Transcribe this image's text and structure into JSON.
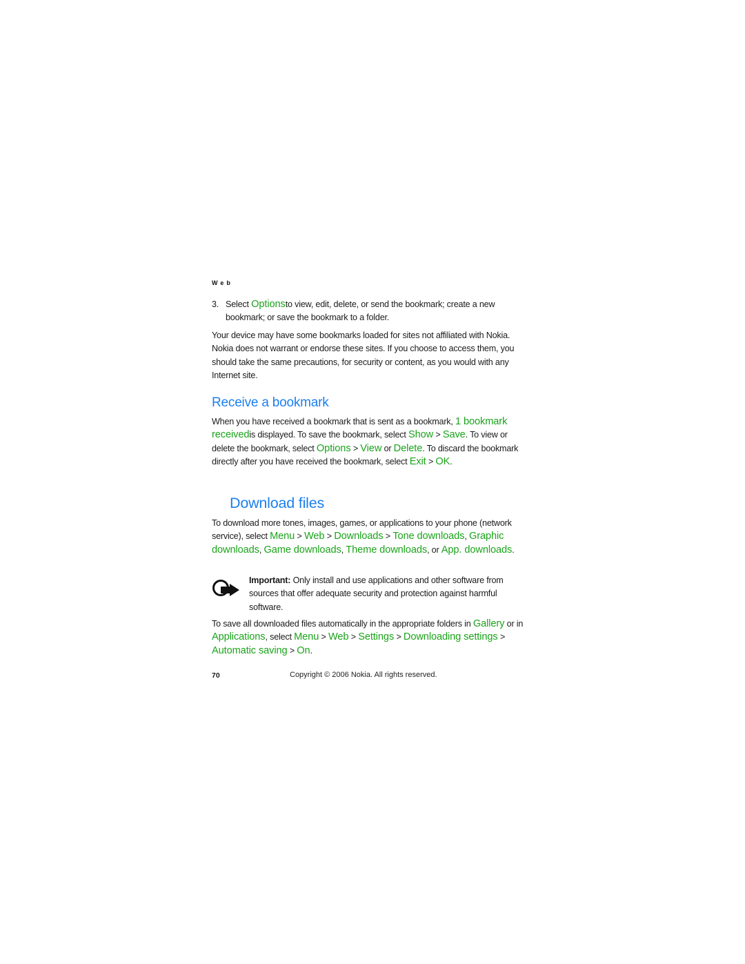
{
  "running_head": "Web",
  "step3": {
    "number": "3.",
    "pre": "Select ",
    "options": "Options",
    "post": "to view, edit, delete, or send the bookmark; create a new bookmark; or save the bookmark to a folder."
  },
  "disclaimer": "Your device may have some bookmarks loaded for sites not affiliated with Nokia. Nokia does not warrant or endorse these sites. If you choose to access them, you should take the same precautions, for security or content, as you would with any Internet site.",
  "receive_section": {
    "heading": "Receive a bookmark",
    "t1": "When you have received a bookmark that is sent as a bookmark, ",
    "g_received": "1 bookmark received",
    "t2": "is displayed. To save the bookmark, select ",
    "g_show": "Show",
    "sep1": " > ",
    "g_save": "Save",
    "t3": ". To view or delete the bookmark, select ",
    "g_options": "Options",
    "sep2": " > ",
    "g_view": "View",
    "t4": " or ",
    "g_delete": "Delete",
    "t5": ". To discard the bookmark directly after you have received the bookmark, select ",
    "g_exit": "Exit",
    "sep3": " > ",
    "g_ok": "OK",
    "t6": "."
  },
  "download_section": {
    "heading": "Download files",
    "t1": "To download more tones, images, games, or applications to your phone (network service), select ",
    "g_menu": "Menu",
    "sep1": " > ",
    "g_web": "Web",
    "sep2": " > ",
    "g_downloads": "Downloads",
    "sep3": " > ",
    "g_tone": "Tone downloads",
    "c1": ", ",
    "g_graphic": "Graphic downloads",
    "c2": ", ",
    "g_game": "Game downloads",
    "c3": ", ",
    "g_theme": "Theme downloads",
    "t2": ", or ",
    "g_app": "App. downloads",
    "t3": "."
  },
  "important_note": {
    "label": "Important:",
    "text": " Only install and use applications and other software from sources that offer adequate security and protection against harmful software."
  },
  "autosave": {
    "t1": "To save all downloaded files automatically in the appropriate folders in ",
    "g_gallery": "Gallery",
    "t2": " or in ",
    "g_applications": "Applications",
    "t3": ", select ",
    "g_menu": "Menu",
    "sep1": " > ",
    "g_web": "Web",
    "sep2": " > ",
    "g_settings": "Settings",
    "sep3": " > ",
    "g_dl_settings": "Downloading settings",
    "sep4": " > ",
    "g_auto": "Automatic saving",
    "sep5": " > ",
    "g_on": "On",
    "t4": "."
  },
  "footer": {
    "page_number": "70",
    "copyright": "Copyright © 2006 Nokia. All rights reserved."
  },
  "colors": {
    "heading_blue": "#1a7ff0",
    "menu_green": "#1aa31a",
    "text": "#1a1a1a"
  }
}
